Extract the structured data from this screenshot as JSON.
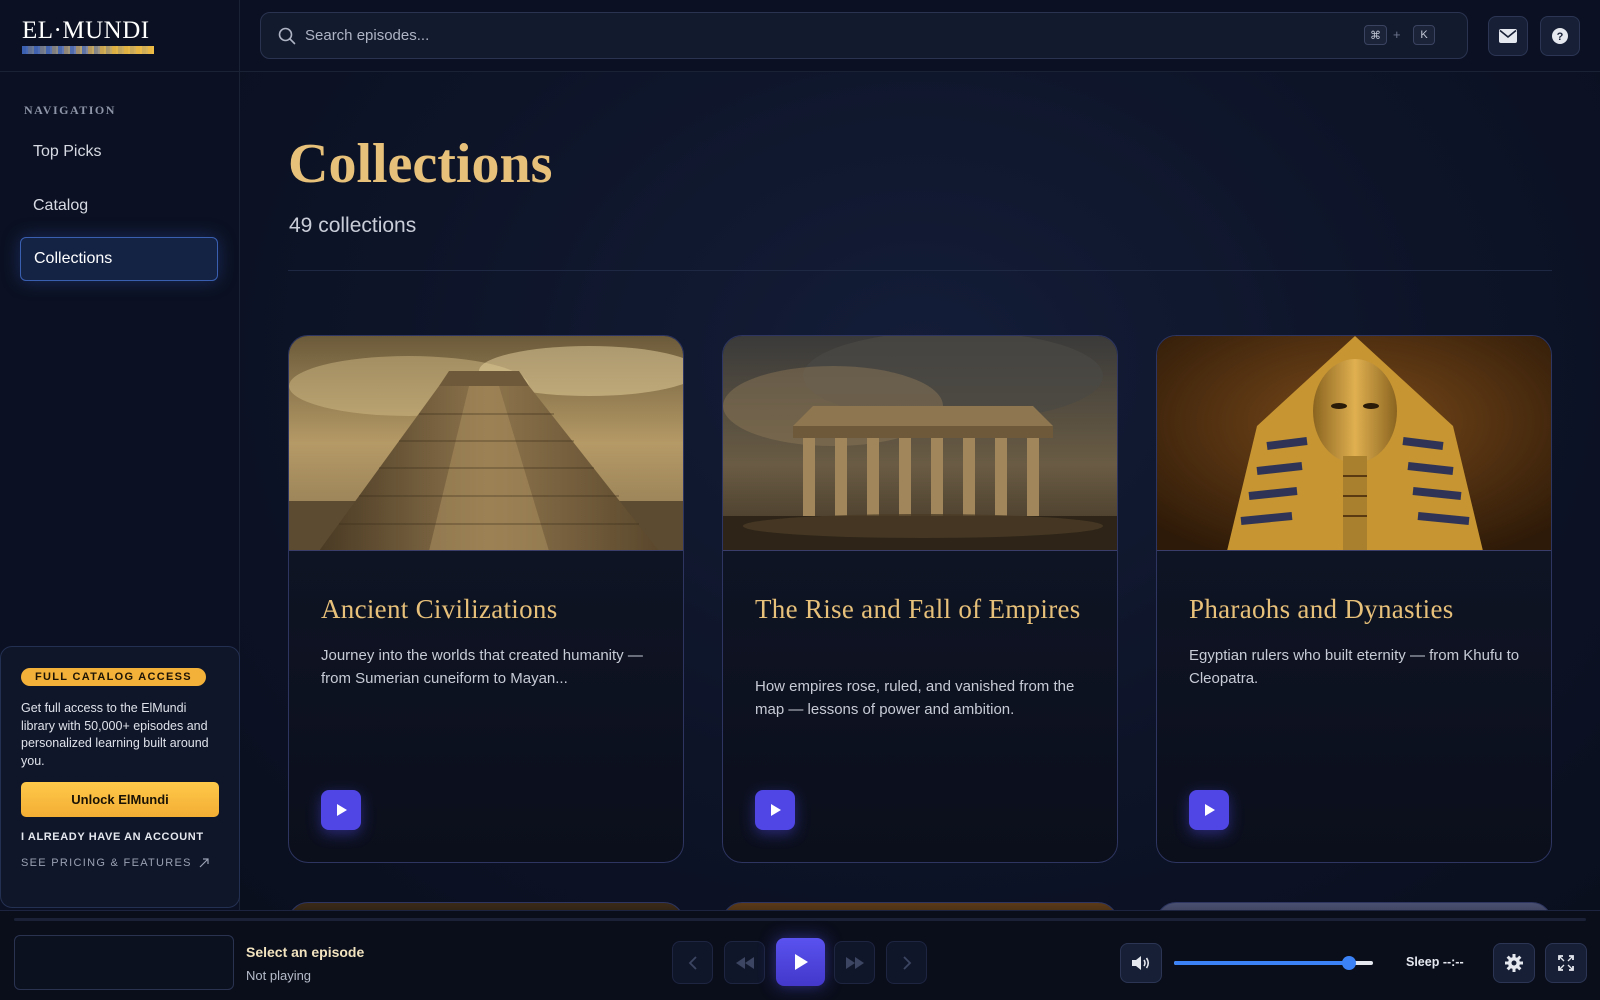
{
  "brand": {
    "logo_text": "EL·MUNDI"
  },
  "navigation": {
    "heading": "NAVIGATION",
    "items": [
      {
        "label": "Top Picks",
        "active": false
      },
      {
        "label": "Catalog",
        "active": false
      },
      {
        "label": "Collections",
        "active": true
      }
    ]
  },
  "promo": {
    "badge": "FULL CATALOG ACCESS",
    "text": "Get full access to the ElMundi library with 50,000+ episodes and personalized learning built around you.",
    "button": "Unlock ElMundi",
    "login_link": "I ALREADY HAVE AN ACCOUNT",
    "pricing_link": "SEE PRICING & FEATURES"
  },
  "search": {
    "placeholder": "Search episodes...",
    "value": "",
    "shortcut_keys": [
      "⌘",
      "K"
    ],
    "shortcut_joiner": "+"
  },
  "header_icons": [
    "mail-icon",
    "help-icon"
  ],
  "page": {
    "title": "Collections",
    "count": "49 collections"
  },
  "collections": [
    {
      "title": "Ancient Civilizations",
      "description": "Journey into the worlds that created humanity — from Sumerian cuneiform to Mayan..."
    },
    {
      "title": "The Rise and Fall of Empires",
      "description": "How empires rose, ruled, and vanished from the map — lessons of power and ambition."
    },
    {
      "title": "Pharaohs and Dynasties",
      "description": "Egyptian rulers who built eternity — from Khufu to Cleopatra."
    }
  ],
  "player": {
    "track_title": "Select an episode",
    "track_status": "Not playing",
    "volume": 0.88,
    "sleep_label": "Sleep --:--",
    "controls": [
      "previous-icon",
      "rewind-icon",
      "play-icon",
      "fast-forward-icon",
      "next-icon"
    ]
  },
  "colors": {
    "accent_gold": "#e7c079",
    "accent_indigo": "#4f46e5",
    "promo_yellow": "#f3b13a",
    "background": "#0a0f1e"
  }
}
